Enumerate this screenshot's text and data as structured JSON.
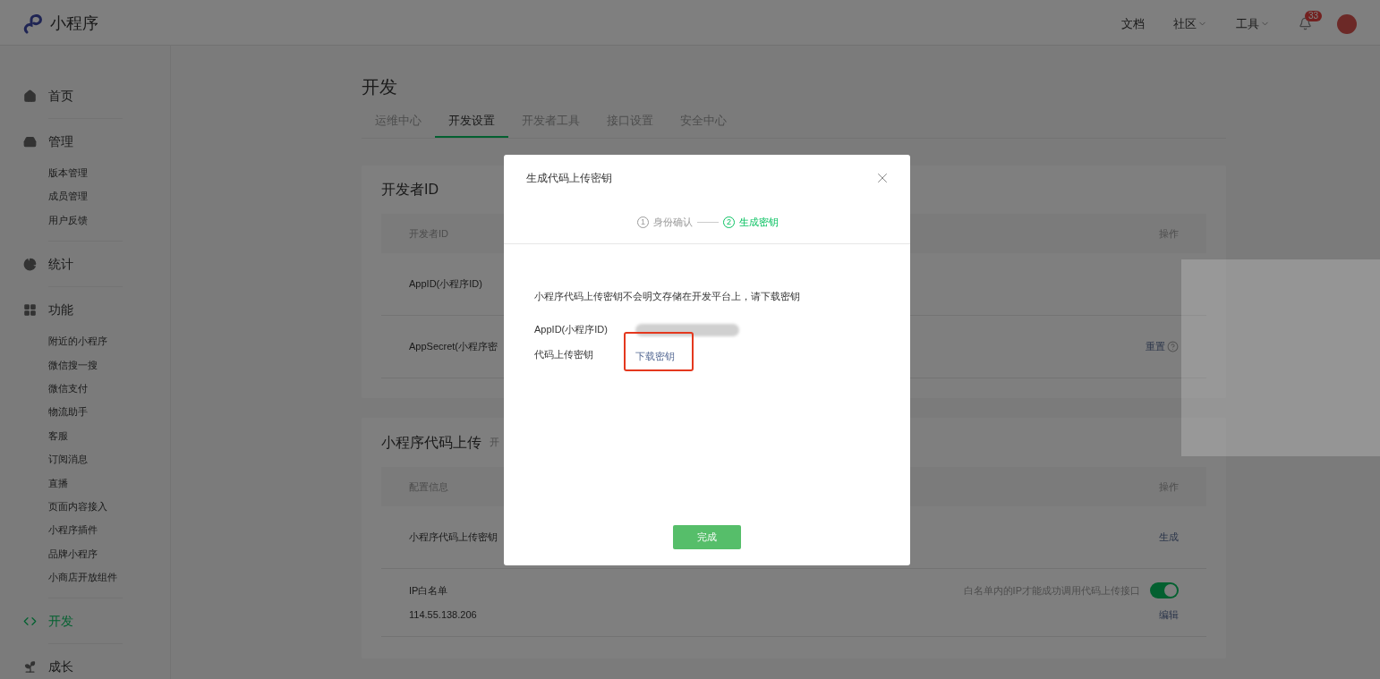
{
  "header": {
    "logo_text": "小程序",
    "nav": [
      {
        "label": "文档",
        "kind": "link"
      },
      {
        "label": "社区",
        "kind": "menu"
      },
      {
        "label": "工具",
        "kind": "menu"
      }
    ],
    "notification_count": "33"
  },
  "sidebar": {
    "sections": [
      {
        "label": "首页",
        "selected": false
      },
      {
        "label": "管理",
        "selected": false,
        "children": [
          "版本管理",
          "成员管理",
          "用户反馈"
        ]
      },
      {
        "label": "统计",
        "selected": false
      },
      {
        "label": "功能",
        "selected": false,
        "children": [
          "附近的小程序",
          "微信搜一搜",
          "微信支付",
          "物流助手",
          "客服",
          "订阅消息",
          "直播",
          "页面内容接入",
          "小程序插件",
          "品牌小程序",
          "小商店开放组件"
        ]
      },
      {
        "label": "开发",
        "selected": true
      },
      {
        "label": "成长",
        "selected": false
      }
    ]
  },
  "page_title": "开发",
  "tabs": [
    {
      "label": "运维中心",
      "selected": false
    },
    {
      "label": "开发设置",
      "selected": true
    },
    {
      "label": "开发者工具",
      "selected": false
    },
    {
      "label": "接口设置",
      "selected": false
    },
    {
      "label": "安全中心",
      "selected": false
    }
  ],
  "developer_id_card": {
    "title": "开发者ID",
    "columns": [
      "开发者ID",
      "操作"
    ],
    "rows": [
      {
        "label": "AppID(小程序ID)"
      },
      {
        "label": "AppSecret(小程序密",
        "action": "重置"
      }
    ]
  },
  "upload_card": {
    "title": "小程序代码上传",
    "subtitle": "开",
    "columns": [
      "配置信息",
      "操作"
    ],
    "key_row": {
      "label": "小程序代码上传密钥",
      "action": "生成"
    },
    "ip_row": {
      "label": "IP白名单",
      "value": "114.55.138.206",
      "hint": "白名单内的IP才能成功调用代码上传接口",
      "on": true,
      "action": "编辑"
    }
  },
  "dialog": {
    "title": "生成代码上传密钥",
    "steps": [
      {
        "number": "1",
        "label": "身份确认",
        "selected": false
      },
      {
        "number": "2",
        "label": "生成密钥",
        "selected": true
      }
    ],
    "message": "小程序代码上传密钥不会明文存储在开发平台上，请下载密钥",
    "fields": [
      {
        "kind": "redacted",
        "label": "AppID(小程序ID)"
      },
      {
        "kind": "link",
        "label": "代码上传密钥",
        "link": "下载密钥"
      }
    ],
    "button": "完成"
  }
}
